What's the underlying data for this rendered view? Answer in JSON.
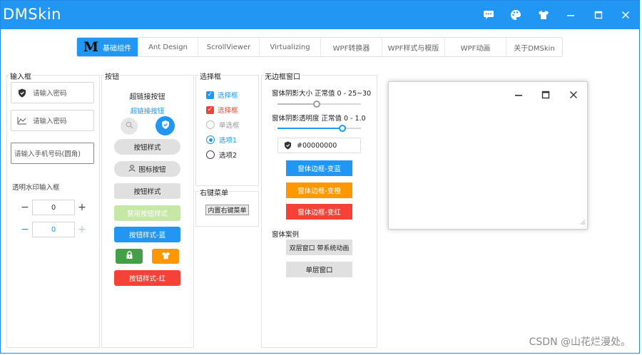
{
  "app": {
    "title": "DMSkin",
    "window_buttons": [
      "chat-icon",
      "palette-icon",
      "shirt-icon",
      "minimize-icon",
      "maximize-icon",
      "close-icon"
    ]
  },
  "tabs": [
    {
      "label": "基础组件",
      "active": true
    },
    {
      "label": "Ant Design"
    },
    {
      "label": "ScrollViewer"
    },
    {
      "label": "Virtualizing"
    },
    {
      "label": "WPF转换器"
    },
    {
      "label": "WPF样式与模版"
    },
    {
      "label": "WPF动画"
    },
    {
      "label": "关于DMSkin"
    }
  ],
  "colors": {
    "accent": "#2196f3",
    "orange": "#ff9800",
    "red": "#f44336",
    "green": "#43a047",
    "disabled_green": "#c5e8a7",
    "gray_btn": "#e0e0e0"
  },
  "input_group": {
    "title": "输入框",
    "password1": {
      "placeholder": "请输入密码",
      "icon": "shield-icon"
    },
    "password2": {
      "placeholder": "请输入密码",
      "icon": "chart-icon"
    },
    "phone": {
      "placeholder": "请输入手机号码(圆角)"
    },
    "watermark_label": "透明水印输入框",
    "stepper1": {
      "value": "0"
    },
    "stepper2": {
      "value": "0"
    }
  },
  "button_group": {
    "title": "按钮",
    "hyperlink_button": "超链接按钮",
    "hyperlink_button_blue": "超链接按钮",
    "style_button": "按钮样式",
    "icon_button": "图标按钮",
    "plain_button": "按钮样式",
    "disabled_button": "禁用按钮样式",
    "blue_button": "按钮样式-蓝",
    "red_button": "按钮样式-红"
  },
  "select_group": {
    "title": "选择框",
    "checkbox1": {
      "label": "选择框",
      "checked": true
    },
    "checkbox2": {
      "label": "选择框",
      "checked": true
    },
    "radio_disabled": "单选框",
    "radio1": {
      "label": "选项1",
      "selected": true
    },
    "radio2": {
      "label": "选项2",
      "selected": false
    }
  },
  "context_menu_group": {
    "title": "右键菜单",
    "button": "内置右键菜单"
  },
  "borderless_group": {
    "title": "无边框窗口",
    "shadow_size_label": "窗体阴影大小 正常值 0 - 25~30",
    "shadow_size_fraction": 0.47,
    "shadow_opacity_label": "窗体阴影透明度 正常值 0 - 1.0",
    "shadow_opacity_fraction": 0.78,
    "color_value": "#00000000",
    "border_blue": "窗体边框-变蓝",
    "border_orange": "窗体边框-变橙",
    "border_red": "窗体边框-变红",
    "examples_label": "窗体案例",
    "double_window": "双层窗口 带系统动画",
    "single_window": "单层窗口"
  },
  "watermark": "CSDN @山花烂漫处。"
}
